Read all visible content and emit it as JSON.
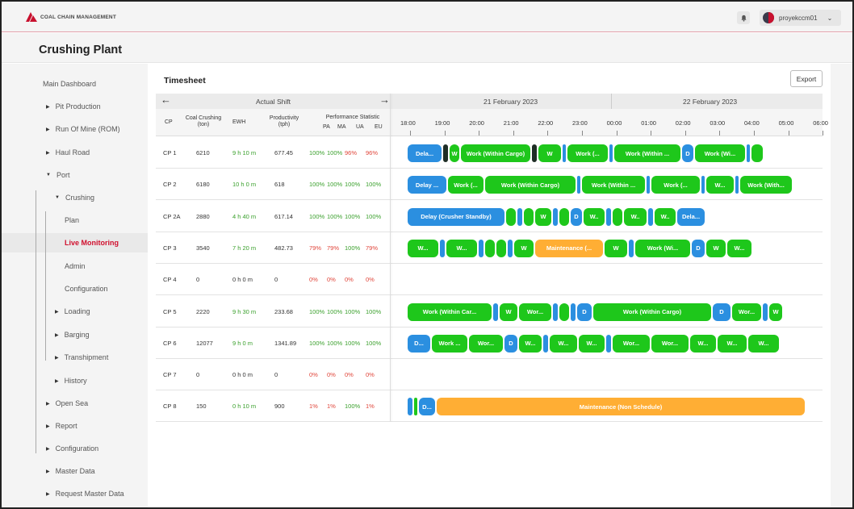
{
  "header": {
    "logo_text": "COAL CHAIN MANAGEMENT",
    "user_name": "proyekccm01",
    "bell_icon": "bell-icon",
    "accent_color": "#c8102e"
  },
  "page_title": "Crushing Plant",
  "sidebar": {
    "main_dashboard": "Main Dashboard",
    "pit_production": "Pit Production",
    "run_of_mine": "Run Of Mine (ROM)",
    "haul_road": "Haul Road",
    "port": "Port",
    "crushing": "Crushing",
    "plan": "Plan",
    "live_monitoring": "Live Monitoring",
    "admin": "Admin",
    "configuration_sub": "Configuration",
    "loading": "Loading",
    "barging": "Barging",
    "transhipment": "Transhipment",
    "history": "History",
    "open_sea": "Open Sea",
    "report": "Report",
    "configuration": "Configuration",
    "master_data": "Master Data",
    "request_master_data": "Request Master Data"
  },
  "timesheet": {
    "title": "Timesheet",
    "export_label": "Export",
    "actual_shift": "Actual Shift",
    "date1": "21 February 2023",
    "date2": "22 February 2023",
    "col_cp": "CP",
    "col_coal_crushing": "Coal Crushing",
    "col_coal_crushing_unit": "(ton)",
    "col_ewh": "EWH",
    "col_productivity": "Productivity",
    "col_productivity_unit": "(tph)",
    "col_perf": "Performance Statistic",
    "col_pa": "PA",
    "col_ma": "MA",
    "col_ua": "UA",
    "col_eu": "EU",
    "times": [
      "18:00",
      "19:00",
      "20:00",
      "21:00",
      "22:00",
      "23:00",
      "00:00",
      "01:00",
      "02:00",
      "03:00",
      "04:00",
      "05:00",
      "06:00"
    ]
  },
  "rows": [
    {
      "cp": "CP 1",
      "coal": "6210",
      "ewh": "9 h 10 m",
      "prod": "677.45",
      "pa": "100%",
      "ma": "100%",
      "ua": "96%",
      "eu": "96%",
      "segs": [
        [
          "blue",
          "Dela..."
        ],
        [
          "dark",
          ""
        ],
        [
          "green",
          "W"
        ],
        [
          "green",
          "Work (Within Cargo)"
        ],
        [
          "dark",
          ""
        ],
        [
          "green",
          "W"
        ],
        [
          "blue",
          ""
        ],
        [
          "green",
          "Work (..."
        ],
        [
          "blue",
          ""
        ],
        [
          "green",
          "Work (Within ..."
        ],
        [
          "blue",
          "D"
        ],
        [
          "green",
          "Work (Wi..."
        ],
        [
          "blue",
          ""
        ],
        [
          "green",
          ""
        ]
      ]
    },
    {
      "cp": "CP 2",
      "coal": "6180",
      "ewh": "10 h 0 m",
      "prod": "618",
      "pa": "100%",
      "ma": "100%",
      "ua": "100%",
      "eu": "100%",
      "segs": [
        [
          "blue",
          "Delay ..."
        ],
        [
          "green",
          "Work (..."
        ],
        [
          "green",
          "Work (Within Cargo)"
        ],
        [
          "blue",
          ""
        ],
        [
          "green",
          "Work (Within ..."
        ],
        [
          "blue",
          ""
        ],
        [
          "green",
          "Work (..."
        ],
        [
          "blue",
          ""
        ],
        [
          "green",
          "W..."
        ],
        [
          "blue",
          ""
        ],
        [
          "green",
          "Work (With..."
        ]
      ]
    },
    {
      "cp": "CP 2A",
      "coal": "2880",
      "ewh": "4 h 40 m",
      "prod": "617.14",
      "pa": "100%",
      "ma": "100%",
      "ua": "100%",
      "eu": "100%",
      "segs": [
        [
          "blue",
          "Delay (Crusher Standby)"
        ],
        [
          "green",
          ""
        ],
        [
          "blue",
          ""
        ],
        [
          "green",
          ""
        ],
        [
          "green",
          "W"
        ],
        [
          "blue",
          ""
        ],
        [
          "green",
          ""
        ],
        [
          "blue",
          "D"
        ],
        [
          "green",
          "W.."
        ],
        [
          "blue",
          ""
        ],
        [
          "green",
          ""
        ],
        [
          "green",
          "W.."
        ],
        [
          "blue",
          ""
        ],
        [
          "green",
          "W.."
        ],
        [
          "blue",
          "Dela..."
        ]
      ]
    },
    {
      "cp": "CP 3",
      "coal": "3540",
      "ewh": "7 h 20 m",
      "prod": "482.73",
      "pa": "79%",
      "ma": "79%",
      "ua": "100%",
      "eu": "79%",
      "segs": [
        [
          "green",
          "W..."
        ],
        [
          "blue",
          ""
        ],
        [
          "green",
          "W..."
        ],
        [
          "blue",
          ""
        ],
        [
          "green",
          ""
        ],
        [
          "green",
          ""
        ],
        [
          "blue",
          ""
        ],
        [
          "green",
          "W"
        ],
        [
          "orange",
          "Maintenance (..."
        ],
        [
          "green",
          "W"
        ],
        [
          "blue",
          ""
        ],
        [
          "green",
          "Work (Wi..."
        ],
        [
          "blue",
          "D"
        ],
        [
          "green",
          "W"
        ],
        [
          "green",
          "W..."
        ]
      ]
    },
    {
      "cp": "CP 4",
      "coal": "0",
      "ewh": "0 h 0 m",
      "prod": "0",
      "pa": "0%",
      "ma": "0%",
      "ua": "0%",
      "eu": "0%",
      "segs": []
    },
    {
      "cp": "CP 5",
      "coal": "2220",
      "ewh": "9 h 30 m",
      "prod": "233.68",
      "pa": "100%",
      "ma": "100%",
      "ua": "100%",
      "eu": "100%",
      "segs": [
        [
          "green",
          "Work (Within Car..."
        ],
        [
          "blue",
          ""
        ],
        [
          "green",
          "W"
        ],
        [
          "green",
          "Wor..."
        ],
        [
          "blue",
          ""
        ],
        [
          "green",
          ""
        ],
        [
          "blue",
          ""
        ],
        [
          "blue",
          "D"
        ],
        [
          "green",
          "Work (Within Cargo)"
        ],
        [
          "blue",
          "D"
        ],
        [
          "green",
          "Wor..."
        ],
        [
          "blue",
          ""
        ],
        [
          "green",
          "W"
        ]
      ]
    },
    {
      "cp": "CP 6",
      "coal": "12077",
      "ewh": "9 h 0 m",
      "prod": "1341.89",
      "pa": "100%",
      "ma": "100%",
      "ua": "100%",
      "eu": "100%",
      "segs": [
        [
          "blue",
          "D..."
        ],
        [
          "green",
          "Work ..."
        ],
        [
          "green",
          "Wor..."
        ],
        [
          "blue",
          "D"
        ],
        [
          "green",
          "W..."
        ],
        [
          "blue",
          ""
        ],
        [
          "green",
          "W..."
        ],
        [
          "green",
          "W..."
        ],
        [
          "blue",
          ""
        ],
        [
          "green",
          "Wor..."
        ],
        [
          "green",
          "Wor..."
        ],
        [
          "green",
          "W..."
        ],
        [
          "green",
          "W..."
        ],
        [
          "green",
          "W..."
        ]
      ]
    },
    {
      "cp": "CP 7",
      "coal": "0",
      "ewh": "0 h 0 m",
      "prod": "0",
      "pa": "0%",
      "ma": "0%",
      "ua": "0%",
      "eu": "0%",
      "segs": []
    },
    {
      "cp": "CP 8",
      "coal": "150",
      "ewh": "0 h 10 m",
      "prod": "900",
      "pa": "1%",
      "ma": "1%",
      "ua": "100%",
      "eu": "1%",
      "segs": [
        [
          "blue",
          ""
        ],
        [
          "green",
          ""
        ],
        [
          "blue",
          "D..."
        ],
        [
          "orange",
          "Maintenance (Non Schedule)"
        ]
      ]
    }
  ]
}
